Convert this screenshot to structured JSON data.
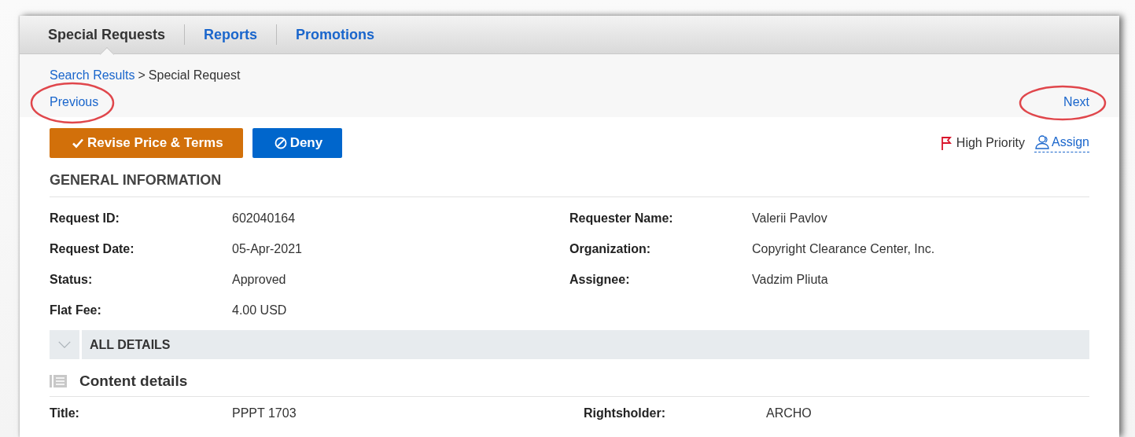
{
  "tabs": [
    {
      "label": "Special Requests",
      "selected": true
    },
    {
      "label": "Reports",
      "selected": false
    },
    {
      "label": "Promotions",
      "selected": false
    }
  ],
  "breadcrumb": {
    "link": "Search Results",
    "separator": ">",
    "current": "Special Request"
  },
  "pager": {
    "previous": "Previous",
    "next": "Next"
  },
  "actions": [
    {
      "kind": "approve",
      "label": "Revise Price & Terms"
    },
    {
      "kind": "deny",
      "label": "Deny"
    }
  ],
  "priority": {
    "label": "High Priority",
    "on": true
  },
  "assign": "Assign",
  "general_information": {
    "title": "GENERAL INFORMATION",
    "fields": [
      {
        "label": "Request ID:",
        "value": "602040164"
      },
      {
        "label": "Requester Name:",
        "value": "Valerii Pavlov"
      },
      {
        "label": "Request Date:",
        "value": "05-Apr-2021"
      },
      {
        "label": "Organization:",
        "value": "Copyright Clearance Center, Inc."
      },
      {
        "label": "Status:",
        "value": "Approved"
      },
      {
        "label": "Assignee:",
        "value": "Vadzim Pliuta"
      },
      {
        "label": "Flat Fee:",
        "value": "4.00 USD"
      }
    ]
  },
  "all_details": {
    "label": "ALL DETAILS",
    "expanded": false
  },
  "content_details": {
    "title": "Content details",
    "fields": [
      {
        "label": "Title:",
        "value": "PPPT 1703"
      },
      {
        "label": "Rightsholder:",
        "value": "ARCHO"
      }
    ]
  }
}
